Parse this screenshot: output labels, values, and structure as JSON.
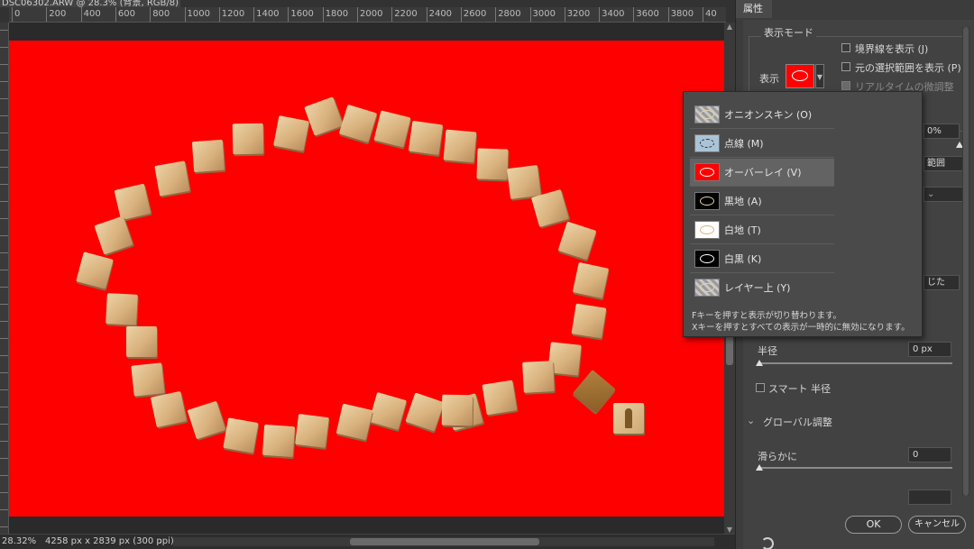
{
  "document": {
    "tab_title": "DSC06302.ARW @ 28.3% (背景, RGB/8)",
    "close_glyph": "×"
  },
  "ruler": {
    "top_labels": [
      "0",
      "200",
      "400",
      "600",
      "800",
      "1000",
      "1200",
      "1400",
      "1600",
      "1800",
      "2000",
      "2200",
      "2400",
      "2600",
      "2800",
      "3000",
      "3200",
      "3400",
      "3600",
      "3800",
      "40"
    ]
  },
  "status": {
    "zoom": "28.32%",
    "doc_size": "4258 px x 2839 px (300 ppi)",
    "chevron": "›"
  },
  "panel": {
    "tab": "属性",
    "display_mode_title": "表示モード",
    "view_label": "表示",
    "show_edges": "境界線を表示 (J)",
    "show_original": "元の選択範囲を表示 (P)",
    "realtime_refine": "リアルタイムの微調整",
    "partial_percent": "0%",
    "partial_range": "範囲",
    "partial_close": "じた",
    "radius_label": "半径",
    "radius_value": "0 px",
    "smart_radius": "スマート 半径",
    "global_refine": "グローバル調整",
    "smooth_label": "滑らかに",
    "smooth_value": "0",
    "ok": "OK",
    "cancel": "キャンセル"
  },
  "view_mode_menu": {
    "options": [
      {
        "label": "オニオンスキン (O)",
        "thumb": "onion-skin"
      },
      {
        "label": "点線 (M)",
        "thumb": "marching-ants"
      },
      {
        "label": "オーバーレイ (V)",
        "thumb": "overlay",
        "selected": true
      },
      {
        "label": "黒地 (A)",
        "thumb": "on-black"
      },
      {
        "label": "白地 (T)",
        "thumb": "on-white"
      },
      {
        "label": "白黒 (K)",
        "thumb": "black-and-white"
      },
      {
        "label": "レイヤー上 (Y)",
        "thumb": "on-layers"
      }
    ],
    "note_1": "Fキーを押すと表示が切り替わります。",
    "note_2": "Xキーを押すとすべての表示が一時的に無効になります。"
  },
  "colors": {
    "overlay_red": "#ff0000",
    "panel_bg": "#424242",
    "popup_bg": "#4a4a4a"
  }
}
